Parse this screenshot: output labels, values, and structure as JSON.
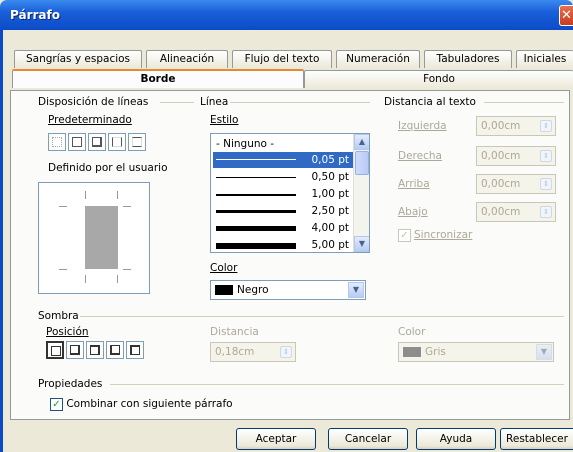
{
  "window": {
    "title": "Párrafo",
    "close": "✕"
  },
  "tabs_top": [
    "Sangrías y espacios",
    "Alineación",
    "Flujo del texto",
    "Numeración",
    "Tabuladores",
    "Iniciales"
  ],
  "tabs_bottom": [
    "Borde",
    "Fondo"
  ],
  "line_arrangement": {
    "title": "Disposición de líneas",
    "default_label": "Predeterminado",
    "user_label": "Definido por el usuario"
  },
  "line": {
    "title": "Línea",
    "style_label": "Estilo",
    "styles": [
      {
        "label": "- Ninguno -",
        "value": ""
      },
      {
        "label": "",
        "value": "0,05 pt"
      },
      {
        "label": "",
        "value": "0,50 pt"
      },
      {
        "label": "",
        "value": "1,00 pt"
      },
      {
        "label": "",
        "value": "2,50 pt"
      },
      {
        "label": "",
        "value": "4,00 pt"
      },
      {
        "label": "",
        "value": "5,00 pt"
      }
    ],
    "selected_style": "0,05 pt",
    "color_label": "Color",
    "color_value": "Negro"
  },
  "spacing": {
    "title": "Distancia al texto",
    "fields": [
      {
        "label": "Izquierda",
        "value": "0,00cm"
      },
      {
        "label": "Derecha",
        "value": "0,00cm"
      },
      {
        "label": "Arriba",
        "value": "0,00cm"
      },
      {
        "label": "Abajo",
        "value": "0,00cm"
      }
    ],
    "sync_label": "Sincronizar"
  },
  "shadow": {
    "title": "Sombra",
    "position_label": "Posición",
    "distance_label": "Distancia",
    "distance_value": "0,18cm",
    "color_label": "Color",
    "color_value": "Gris"
  },
  "properties": {
    "title": "Propiedades",
    "merge_label": "Combinar con siguiente párrafo"
  },
  "buttons": {
    "ok": "Aceptar",
    "cancel": "Cancelar",
    "help": "Ayuda",
    "reset": "Restablecer"
  }
}
